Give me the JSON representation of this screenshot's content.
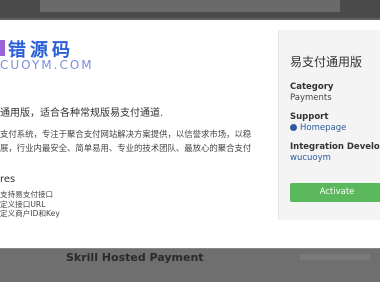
{
  "logo": {
    "cn": "错源码",
    "en": "CUOYM.COM"
  },
  "module": {
    "description": "通用版，适合各种常规版易支付通道.",
    "body_lines": [
      "支付系统，专注于聚合支付网站解决方案提供，以信誉求市场，以稳",
      "展，行业内最安全、简单易用、专业的技术团队、最放心的聚合支付"
    ],
    "features_title": "res",
    "features": [
      "支持易支付接口",
      "定义接口URL",
      "定义商户ID和Key"
    ]
  },
  "sidebar": {
    "title": "易支付通用版",
    "category_label": "Category",
    "category_value": "Payments",
    "support_label": "Support",
    "support_link": "Homepage",
    "developer_label": "Integration Developer",
    "developer_value": "wucuoym",
    "activate_label": "Activate"
  },
  "background": {
    "next_item": "Skrill Hosted Payment"
  }
}
